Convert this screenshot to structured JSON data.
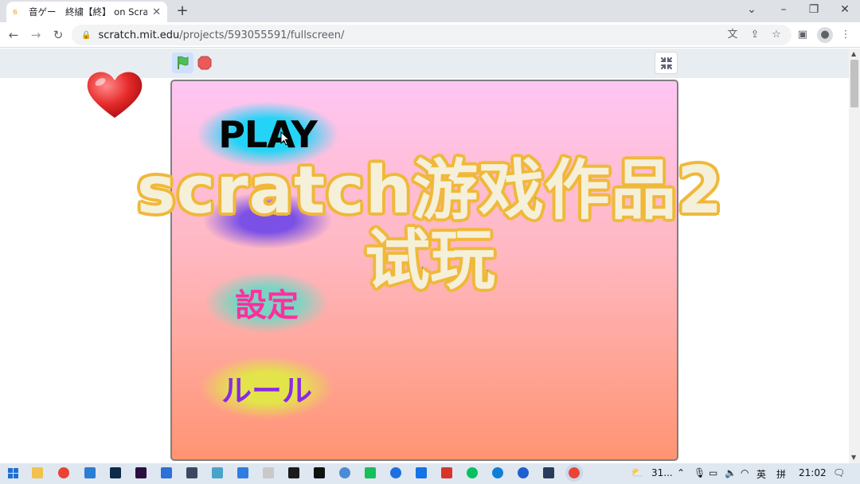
{
  "browser": {
    "tab_title": "音ゲー　終繍【終】 on Scratch",
    "tab_favicon": "scratch-favicon",
    "url_host": "scratch.mit.edu",
    "url_path": "/projects/593055591/fullscreen/"
  },
  "stage": {
    "buttons": {
      "play": "PLAY",
      "settings": "設定",
      "rules": "ルール"
    }
  },
  "overlay": {
    "line1": "scratch游戏作品2",
    "line2": "试玩"
  },
  "taskbar": {
    "weather": "31...",
    "ime": "英",
    "ime_mode": "拼",
    "clock": "21:02"
  },
  "colors": {
    "play_glow": "#24d4f6",
    "settings_text": "#ff2f9f",
    "rules_text": "#8a2be2",
    "overlay_fill": "#f5f0da",
    "overlay_stroke": "#5d8f95",
    "overlay_outline": "#f0b83a"
  }
}
